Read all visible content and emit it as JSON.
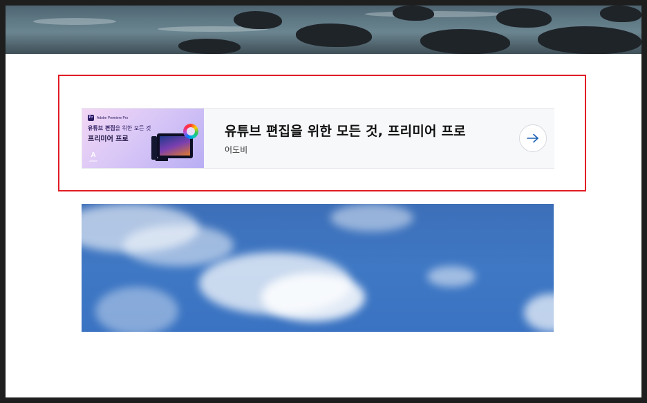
{
  "hero_image": {
    "alt": "coastal-rocks-photo"
  },
  "ad": {
    "thumbnail": {
      "brand": "Adobe Premiere Pro",
      "line1_bold": "유튜브 편집",
      "line1_rest": "을 위한 모든 것",
      "line2": "프리미어 프로",
      "logo_text": "Adobe"
    },
    "title": "유튜브 편집을 위한 모든 것, 프리미어 프로",
    "advertiser": "어도비",
    "arrow_icon": "arrow-right-icon"
  },
  "sky_image": {
    "alt": "blue-sky-clouds-photo"
  },
  "colors": {
    "highlight_border": "#e11c24",
    "arrow_color": "#1a5fb4",
    "background": "#1e1e1e"
  }
}
